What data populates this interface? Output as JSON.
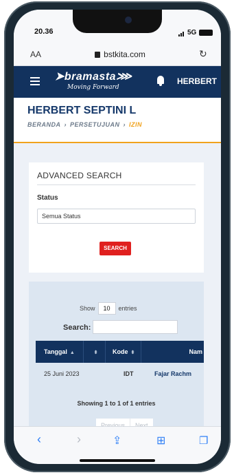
{
  "status_bar": {
    "time": "20.36",
    "network": "5G"
  },
  "browser": {
    "aa_label": "AA",
    "url": "bstkita.com"
  },
  "header": {
    "logo": "bramasta",
    "tagline": "Moving Forward",
    "user": "HERBERT"
  },
  "page": {
    "title": "HERBERT SEPTINI L",
    "breadcrumb": [
      "BERANDA",
      "PERSETUJUAN",
      "IZIN"
    ],
    "breadcrumb_sep": "›"
  },
  "search": {
    "title": "ADVANCED SEARCH",
    "status_label": "Status",
    "status_value": "Semua Status",
    "button": "SEARCH"
  },
  "table": {
    "show_label": "Show",
    "entries_count": "10",
    "entries_label": "entries",
    "search_label": "Search:",
    "columns": [
      "Tanggal",
      "",
      "Kode",
      "Nam"
    ],
    "rows": [
      [
        "25 Juni 2023",
        "",
        "IDT",
        "Fajar Rachm"
      ]
    ],
    "info": "Showing 1 to 1 of 1 entries",
    "prev": "Previous",
    "next": "Next"
  },
  "icons": {
    "menu": "hamburger-icon",
    "notify": "bell-icon",
    "reload": "reload-icon",
    "share": "share-icon",
    "bookmarks": "book-icon",
    "tabs": "tabs-icon"
  },
  "colors": {
    "header": "#12325e",
    "accent": "#f0a21c",
    "button": "#e0201f"
  }
}
